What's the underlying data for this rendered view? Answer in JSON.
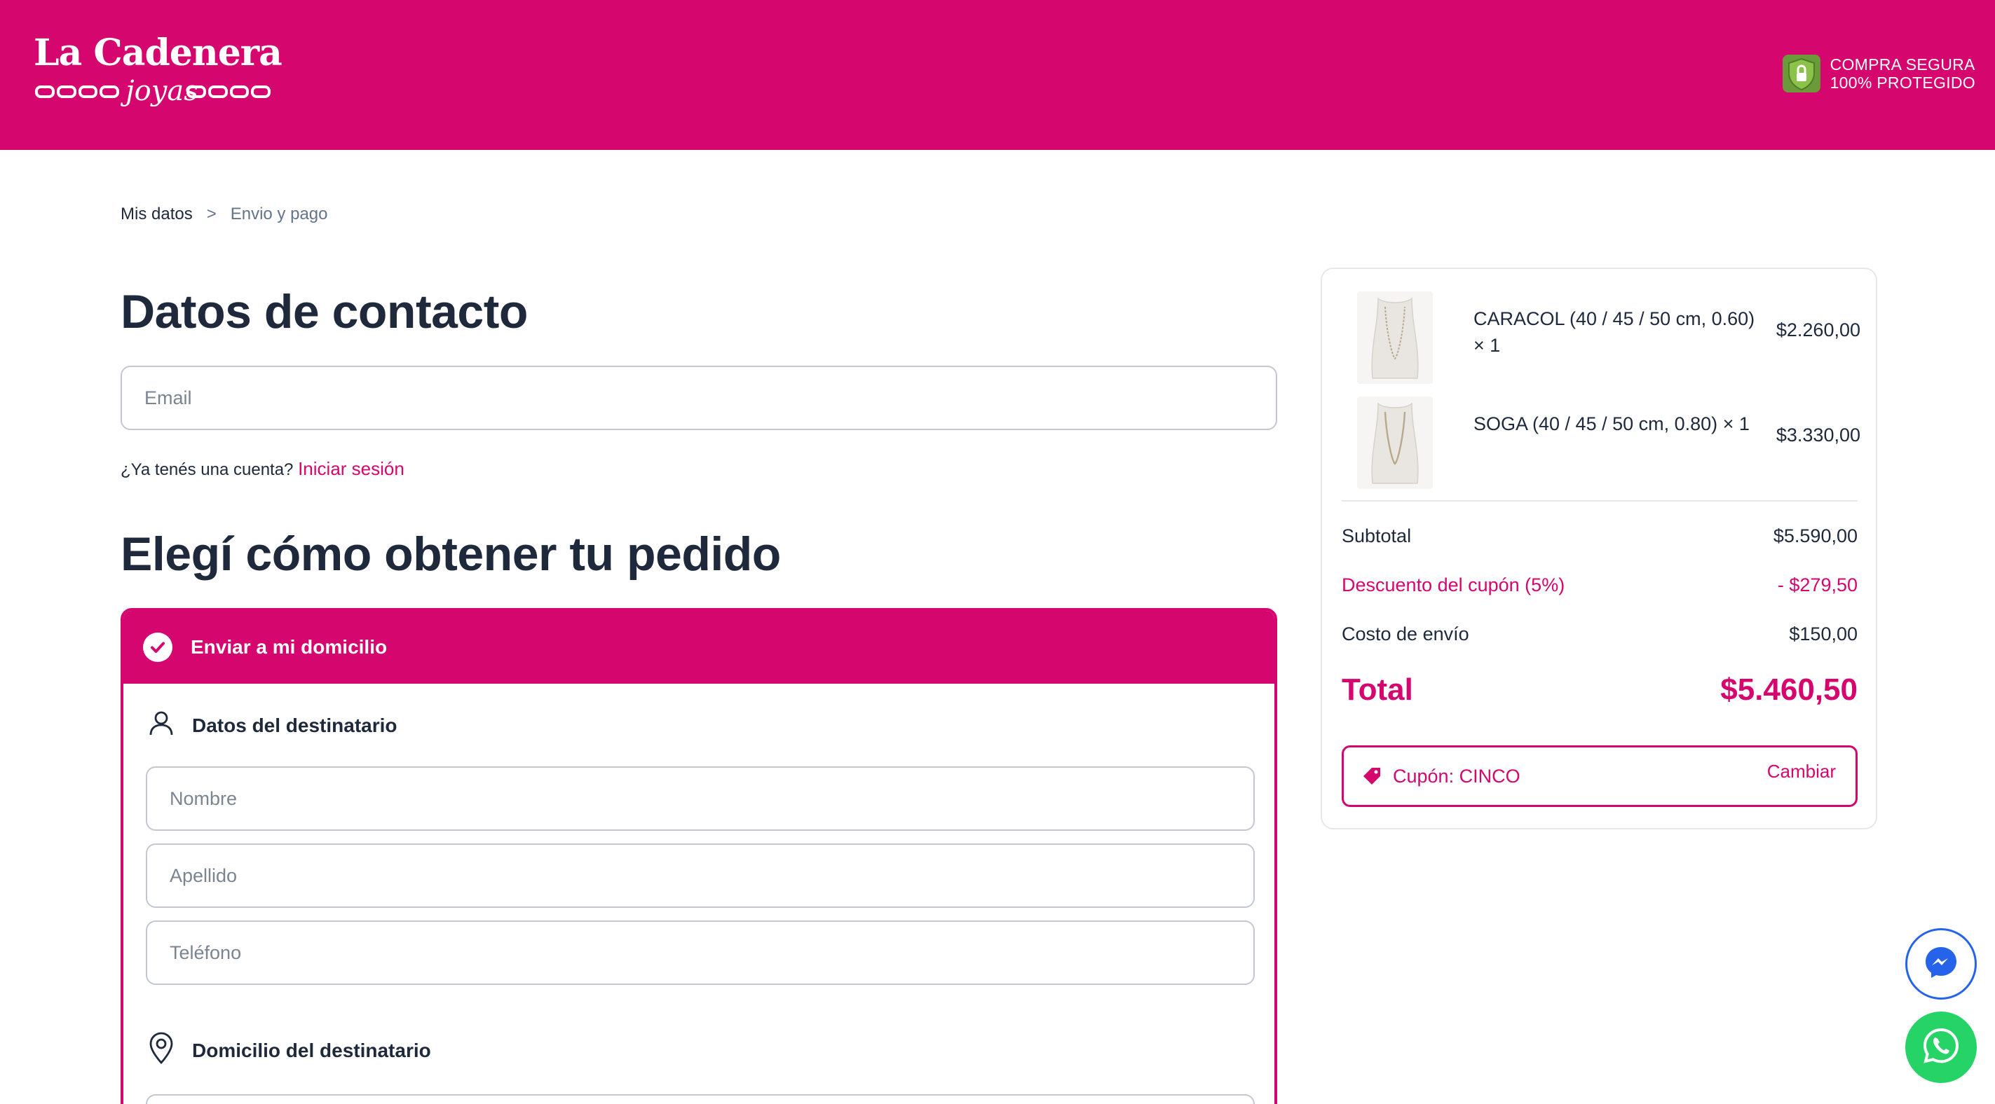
{
  "brand": {
    "name": "La Cadenera",
    "tagline": "joyas"
  },
  "secure_badge": {
    "line1": "COMPRA SEGURA",
    "line2": "100% PROTEGIDO"
  },
  "breadcrumb": {
    "step1": "Mis datos",
    "separator": ">",
    "step2": "Envio y pago"
  },
  "contact": {
    "title": "Datos de contacto",
    "email_placeholder": "Email",
    "account_question": "¿Ya tenés una cuenta?",
    "login_link": "Iniciar sesión"
  },
  "delivery": {
    "title": "Elegí cómo obtener tu pedido",
    "option_label": "Enviar a mi domicilio",
    "recipient_section": "Datos del destinatario",
    "first_name_placeholder": "Nombre",
    "last_name_placeholder": "Apellido",
    "phone_placeholder": "Teléfono",
    "address_section": "Domicilio del destinatario"
  },
  "cart": {
    "items": [
      {
        "name": "CARACOL (40 / 45 / 50 cm, 0.60) × 1",
        "price": "$2.260,00"
      },
      {
        "name": "SOGA (40 / 45 / 50 cm, 0.80) × 1",
        "price": "$3.330,00"
      }
    ],
    "subtotal_label": "Subtotal",
    "subtotal_value": "$5.590,00",
    "discount_label": "Descuento del cupón (5%)",
    "discount_value": "- $279,50",
    "shipping_label": "Costo de envío",
    "shipping_value": "$150,00",
    "total_label": "Total",
    "total_value": "$5.460,50",
    "coupon_label": "Cupón: CINCO",
    "coupon_change": "Cambiar"
  },
  "colors": {
    "brand": "#d6066f",
    "text": "#1e293b",
    "muted": "#7b8491",
    "whatsapp": "#25d366",
    "messenger": "#2563eb"
  },
  "icons": [
    "shield-lock-icon",
    "check-icon",
    "user-icon",
    "location-pin-icon",
    "tag-icon",
    "messenger-icon",
    "whatsapp-icon"
  ]
}
